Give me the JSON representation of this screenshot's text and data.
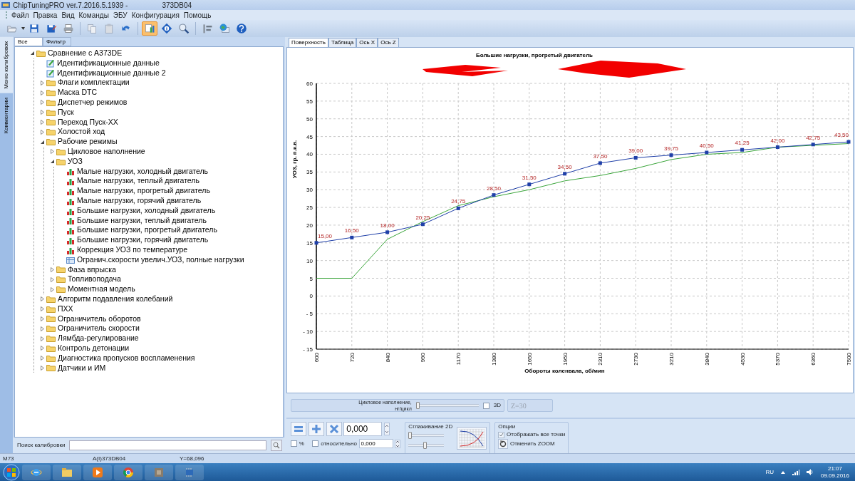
{
  "window": {
    "title": "ChipTuningPRO ver.7.2016.5.1939 -",
    "title_suffix": "373DB04"
  },
  "menu": [
    "Файл",
    "Правка",
    "Вид",
    "Команды",
    "ЭБУ",
    "Конфигурация",
    "Помощь"
  ],
  "toolbar": [
    {
      "kind": "open",
      "selected": false
    },
    {
      "kind": "save",
      "selected": false
    },
    {
      "kind": "saveas",
      "selected": false
    },
    {
      "kind": "print",
      "selected": false
    },
    {
      "kind": "copy",
      "selected": false
    },
    {
      "kind": "paste",
      "selected": false
    },
    {
      "kind": "undo",
      "selected": false
    },
    {
      "kind": "compare",
      "selected": true
    },
    {
      "kind": "info",
      "selected": false
    },
    {
      "kind": "zoom",
      "selected": false
    },
    {
      "kind": "tools",
      "selected": false
    },
    {
      "kind": "globe",
      "selected": false
    },
    {
      "kind": "help",
      "selected": false
    }
  ],
  "side_tabs": [
    {
      "label": "Меню калибровок",
      "selected": true
    },
    {
      "label": "Комментарии",
      "selected": false
    }
  ],
  "filter_tabs": [
    {
      "label": "Все",
      "selected": true
    },
    {
      "label": "Фильтр",
      "selected": false
    }
  ],
  "tree": {
    "items": [
      {
        "label": "Сравнение с A373DE",
        "kind": "folder",
        "expanded": true,
        "children": [
          {
            "label": "Идентификационные данные",
            "kind": "doc"
          },
          {
            "label": "Идентификационные данные 2",
            "kind": "doc"
          },
          {
            "label": "Флаги комплектации",
            "kind": "folder",
            "expanded": false
          },
          {
            "label": "Маска DTC",
            "kind": "folder",
            "expanded": false
          },
          {
            "label": "Диспетчер режимов",
            "kind": "folder",
            "expanded": false
          },
          {
            "label": "Пуск",
            "kind": "folder",
            "expanded": false
          },
          {
            "label": "Переход Пуск-ХХ",
            "kind": "folder",
            "expanded": false
          },
          {
            "label": "Холостой ход",
            "kind": "folder",
            "expanded": false
          },
          {
            "label": "Рабочие режимы",
            "kind": "folder",
            "expanded": true,
            "children": [
              {
                "label": "Цикловое наполнение",
                "kind": "folder",
                "expanded": false
              },
              {
                "label": "УОЗ",
                "kind": "folder",
                "expanded": true,
                "children": [
                  {
                    "label": "Малые нагрузки, холодный двигатель",
                    "kind": "map"
                  },
                  {
                    "label": "Малые нагрузки, теплый двигатель",
                    "kind": "map"
                  },
                  {
                    "label": "Малые нагрузки, прогретый двигатель",
                    "kind": "map"
                  },
                  {
                    "label": "Малые нагрузки, горячий двигатель",
                    "kind": "map"
                  },
                  {
                    "label": "Большие нагрузки, холодный двигатель",
                    "kind": "map"
                  },
                  {
                    "label": "Большие нагрузки, теплый двигатель",
                    "kind": "map"
                  },
                  {
                    "label": "Большие нагрузки, прогретый двигатель",
                    "kind": "map"
                  },
                  {
                    "label": "Большие нагрузки, горячий двигатель",
                    "kind": "map"
                  },
                  {
                    "label": "Коррекция УОЗ по температуре",
                    "kind": "map"
                  },
                  {
                    "label": "Огранич.скорости увелич.УОЗ, полные нагрузки",
                    "kind": "table"
                  }
                ]
              },
              {
                "label": "Фаза впрыска",
                "kind": "folder",
                "expanded": false
              },
              {
                "label": "Топливоподача",
                "kind": "folder",
                "expanded": false
              },
              {
                "label": "Моментная модель",
                "kind": "folder",
                "expanded": false
              }
            ]
          },
          {
            "label": "Алгоритм подавления колебаний",
            "kind": "folder",
            "expanded": false
          },
          {
            "label": "ПХХ",
            "kind": "folder",
            "expanded": false
          },
          {
            "label": "Ограничитель оборотов",
            "kind": "folder",
            "expanded": false
          },
          {
            "label": "Ограничитель скорости",
            "kind": "folder",
            "expanded": false
          },
          {
            "label": "Лямбда-регулирование",
            "kind": "folder",
            "expanded": false
          },
          {
            "label": "Контроль детонации",
            "kind": "folder",
            "expanded": false
          },
          {
            "label": "Диагностика пропусков воспламенения",
            "kind": "folder",
            "expanded": false
          },
          {
            "label": "Датчики и ИМ",
            "kind": "folder",
            "expanded": false
          }
        ]
      }
    ]
  },
  "search": {
    "label": "Поиск калибровки"
  },
  "view_tabs": [
    {
      "label": "Поверхность",
      "selected": true
    },
    {
      "label": "Таблица",
      "selected": false
    },
    {
      "label": "Ось X",
      "selected": false
    },
    {
      "label": "Ось Z",
      "selected": false
    }
  ],
  "chart": {
    "chart_data": {
      "type": "line",
      "title": "Большие нагрузки, прогретый двигатель",
      "xlabel": "Обороты коленвала, об/мин",
      "ylabel": "УОЗ, гр. п.к.в.",
      "categories": [
        "600",
        "720",
        "840",
        "990",
        "1170",
        "1380",
        "1650",
        "1950",
        "2310",
        "2730",
        "3210",
        "3840",
        "4530",
        "5370",
        "6360",
        "7500"
      ],
      "series": [
        {
          "color": "#1f3fa8",
          "marker": "square",
          "values": [
            15,
            16.5,
            18,
            20.25,
            24.75,
            28.5,
            31.5,
            34.5,
            37.5,
            39,
            39.75,
            40.5,
            41.25,
            42,
            42.75,
            43.5
          ]
        },
        {
          "color": "#3aa53a",
          "values": [
            5,
            5,
            16,
            21,
            25.5,
            28,
            30,
            32.5,
            34,
            36,
            38.5,
            40,
            40.5,
            42,
            42.5,
            43
          ]
        }
      ],
      "ylim": [
        -15,
        60
      ],
      "grid": true,
      "yticks": [
        60,
        55,
        50,
        45,
        40,
        35,
        30,
        25,
        20,
        15,
        10,
        5,
        0,
        {
          "value": -5,
          "label": "- 5"
        },
        {
          "value": -10,
          "label": "- 10"
        },
        {
          "value": -15,
          "label": "- 15"
        }
      ],
      "value_labels": [
        "15,00",
        "16,50",
        "18,00",
        "20,25",
        "24,75",
        "28,50",
        "31,50",
        "34,50",
        "37,50",
        "39,00",
        "39,75",
        "40,50",
        "41,25",
        "42,00",
        "42,75",
        "43,50"
      ]
    }
  },
  "slice": {
    "label_line1": "Цикловое наполнение,",
    "label_line2": "нг/цикл",
    "level": 0,
    "three_d_label": "3D",
    "three_d": false,
    "z_value": "Z=30"
  },
  "edit": {
    "value": "0,000",
    "percent_label": "%",
    "percent": false,
    "relative_label": "относительно",
    "relative": false,
    "relative_value": "0,000",
    "smoothing_title": "Сглаживание 2D",
    "smooth_levels": [
      {
        "level": 0
      },
      {
        "level": 0.45
      }
    ],
    "options_title": "Опции",
    "show_all_points_label": "Отображать все точки",
    "show_all_points": true,
    "reset_zoom_label": "Отменить ZOOM"
  },
  "status_bar": [
    "M73",
    "A(I)373DB04",
    "Y=68,096"
  ],
  "taskbar": {
    "language": "RU",
    "time": "21:07",
    "date": "09.09.2016"
  }
}
